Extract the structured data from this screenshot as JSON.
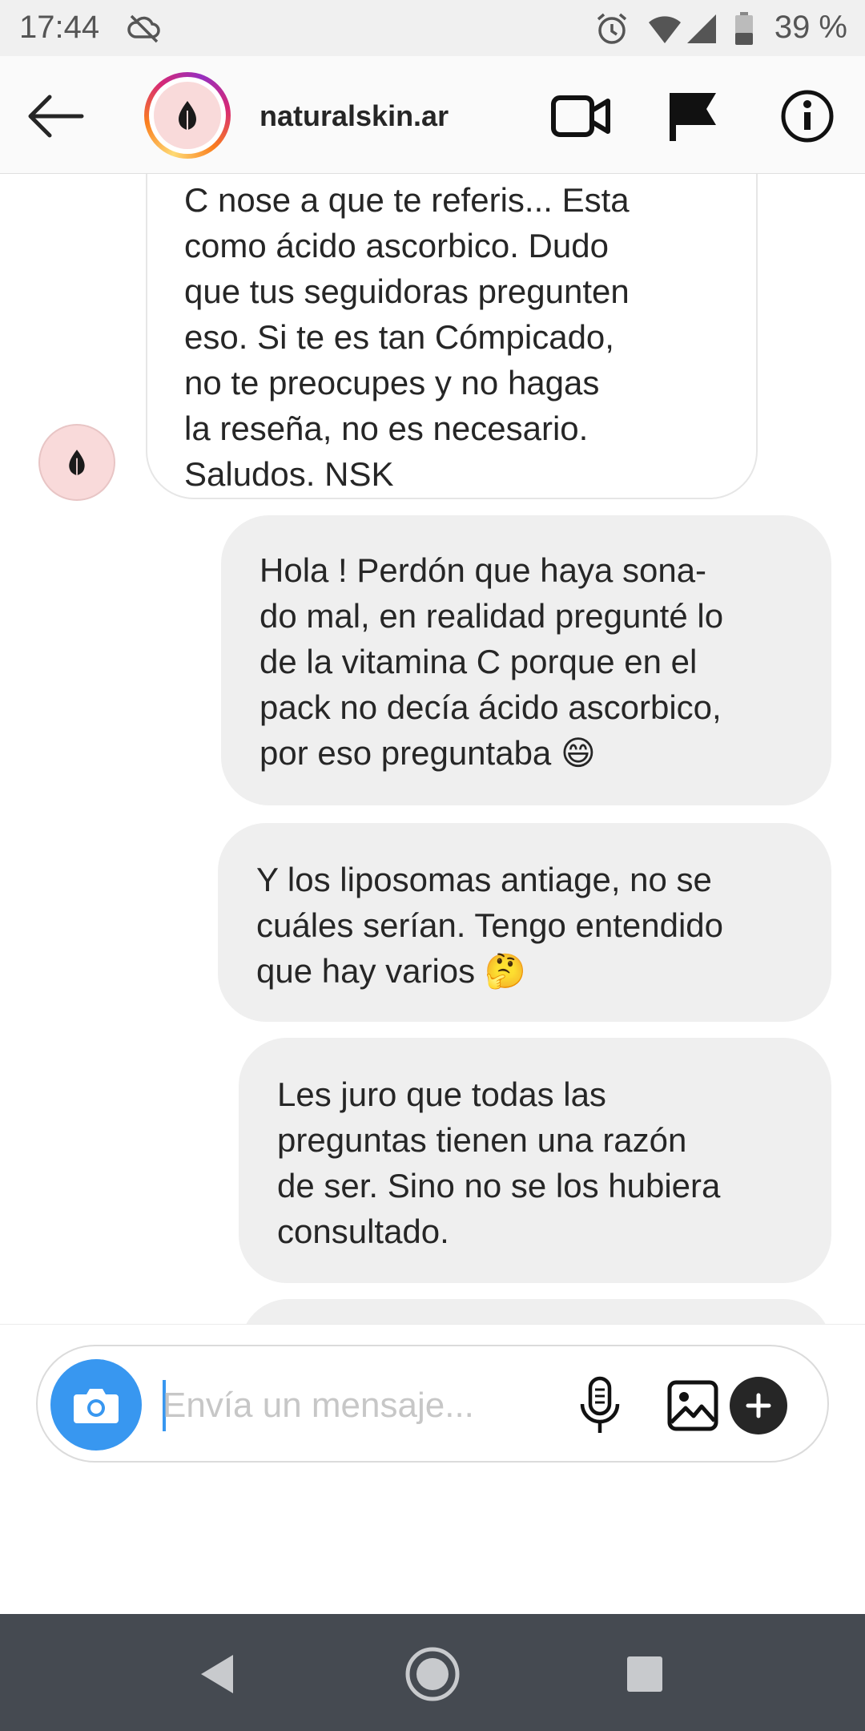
{
  "status_bar": {
    "time": "17:44",
    "battery": "39 %",
    "icons": [
      "cloud-off-icon",
      "alarm-icon",
      "wifi-icon",
      "signal-icon",
      "battery-icon"
    ]
  },
  "header": {
    "username": "naturalskin.ar",
    "icons": [
      "back-arrow-icon",
      "video-call-icon",
      "flag-icon",
      "info-icon"
    ]
  },
  "messages": [
    {
      "direction": "incoming",
      "lines": [
        "C nose a que te referis... Esta",
        "como ácido ascorbico. Dudo",
        "que tus seguidoras pregunten",
        "eso. Si te es tan Cómpicado,",
        "no te preocupes y no hagas",
        "la reseña, no es necesario.",
        "Saludos. NSK"
      ]
    },
    {
      "direction": "outgoing",
      "lines": [
        "Hola !  Perdón que haya sona-",
        "do mal, en realidad pregunté lo",
        "de la vitamina C porque en el",
        "pack no decía ácido ascorbico,",
        "por eso preguntaba 😄"
      ]
    },
    {
      "direction": "outgoing",
      "lines": [
        "Y los liposomas antiage, no se",
        "cuáles serían. Tengo entendido",
        "que hay varios 🤔"
      ]
    },
    {
      "direction": "outgoing",
      "lines": [
        "Les juro que todas las",
        "preguntas tienen una razón",
        "de ser.  Sino no se los hubiera",
        "consultado."
      ]
    }
  ],
  "composer": {
    "placeholder": "Envía un mensaje...",
    "value": "",
    "icons": [
      "camera-icon",
      "microphone-icon",
      "gallery-icon",
      "plus-icon"
    ]
  },
  "nav_bar": {
    "icons": [
      "back-nav-icon",
      "home-nav-icon",
      "recents-nav-icon"
    ]
  },
  "colors": {
    "accent": "#3897f0",
    "outgoing_bubble": "#efefef",
    "nav_bar": "#454a51",
    "status_bar": "#f0f0f0"
  }
}
